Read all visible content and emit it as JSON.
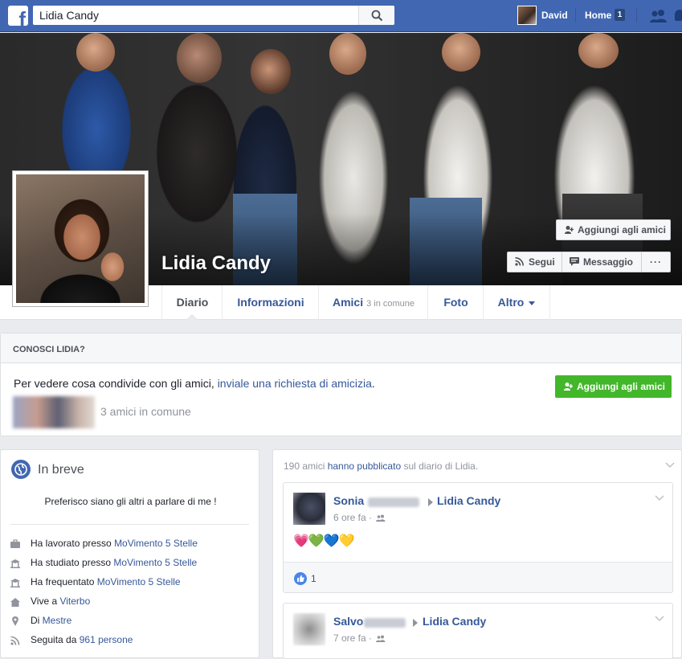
{
  "topbar": {
    "search_value": "Lidia Candy",
    "user_name": "David",
    "home_label": "Home",
    "home_count": "1"
  },
  "profile": {
    "name": "Lidia Candy",
    "add_friend_label": "Aggiungi agli amici",
    "follow_label": "Segui",
    "message_label": "Messaggio",
    "more_label": "···"
  },
  "tabs": [
    {
      "label": "Diario"
    },
    {
      "label": "Informazioni"
    },
    {
      "label": "Amici",
      "sub": "3 in comune"
    },
    {
      "label": "Foto"
    },
    {
      "label": "Altro"
    }
  ],
  "know_card": {
    "title": "CONOSCI LIDIA?",
    "text_prefix": "Per vedere cosa condivide con gli amici, ",
    "text_link": "inviale una richiesta di amicizia",
    "text_suffix": ".",
    "add_label": "Aggiungi agli amici",
    "mutual": "3 amici in comune"
  },
  "intro": {
    "title": "In breve",
    "bio": "Preferisco siano gli altri a parlare di me !",
    "rows": [
      {
        "icon": "briefcase-icon",
        "prefix": "Ha lavorato presso ",
        "link": "MoVimento 5 Stelle"
      },
      {
        "icon": "school-icon",
        "prefix": "Ha studiato presso ",
        "link": "MoVimento 5 Stelle"
      },
      {
        "icon": "school-icon",
        "prefix": "Ha frequentato ",
        "link": "MoVimento 5 Stelle"
      },
      {
        "icon": "home-icon",
        "prefix": "Vive a ",
        "link": "Viterbo"
      },
      {
        "icon": "location-pin-icon",
        "prefix": "Di ",
        "link": "Mestre"
      },
      {
        "icon": "rss-icon",
        "prefix": "Seguita da ",
        "link": "961 persone"
      }
    ]
  },
  "feed": {
    "header_prefix": "190 amici ",
    "header_link": "hanno pubblicato",
    "header_suffix": " sul diario di Lidia.",
    "posts": [
      {
        "author": "Sonia",
        "target": "Lidia Candy",
        "time": "6 ore fa ·",
        "hearts": "💗💚💙💛",
        "likes": "1"
      },
      {
        "author": "Salvo",
        "target": "Lidia Candy",
        "time": "7 ore fa ·"
      }
    ]
  },
  "colors": {
    "brand": "#4267b2",
    "link": "#365899",
    "green_button": "#42b72a"
  }
}
